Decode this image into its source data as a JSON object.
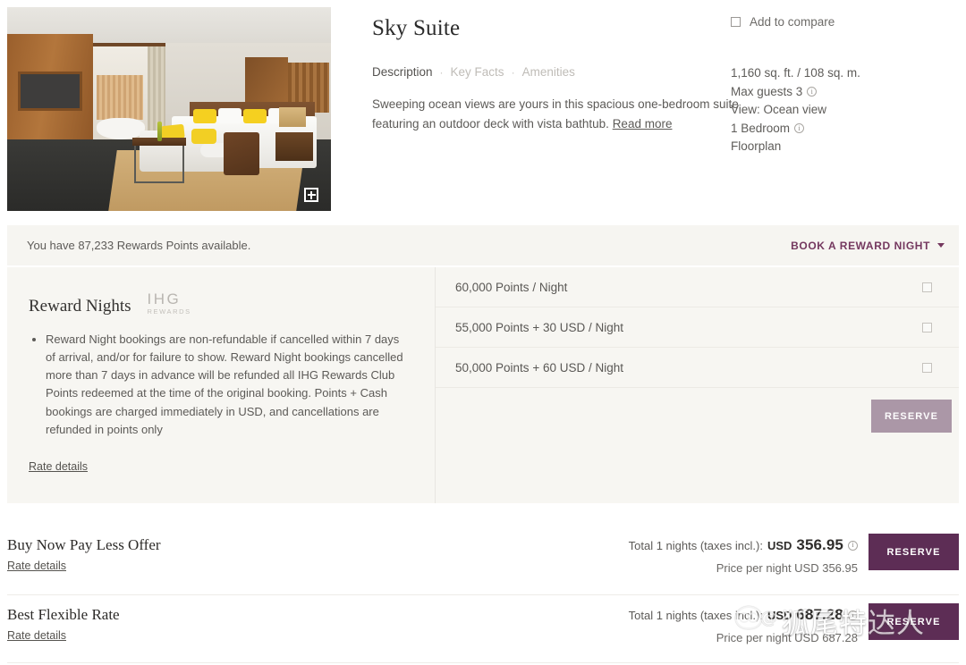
{
  "room": {
    "title": "Sky Suite",
    "photo_alt_name": "suite-photo",
    "expand_icon": "expand-plus-icon",
    "compare_label": "Add to compare",
    "tabs": [
      {
        "label": "Description",
        "active": true
      },
      {
        "label": "Key Facts",
        "active": false
      },
      {
        "label": "Amenities",
        "active": false
      }
    ],
    "tab_separator": "·",
    "description": "Sweeping ocean views are yours in this spacious one-bedroom suite featuring an outdoor deck with vista bathtub.",
    "read_more": "Read more",
    "facts": {
      "size": "1,160 sq. ft. / 108 sq. m.",
      "max_guests": "Max guests 3",
      "view": "View: Ocean view",
      "bedrooms": "1 Bedroom",
      "floorplan": "Floorplan"
    }
  },
  "rewards_banner": {
    "points_available": "You have 87,233 Rewards Points available.",
    "book_link": "BOOK A REWARD NIGHT",
    "chevron_icon": "chevron-down-icon"
  },
  "reward_panel": {
    "title": "Reward Nights",
    "logo_main": "IHG",
    "logo_sub": "REWARDS",
    "terms": "Reward Night bookings are non-refundable if cancelled within 7 days of arrival, and/or for failure to show. Reward Night bookings cancelled more than 7 days in advance will be refunded all IHG Rewards Club Points redeemed at the time of the original booking. Points + Cash bookings are charged immediately in USD, and cancellations are refunded in points only",
    "rate_details": "Rate details",
    "options": [
      {
        "label": "60,000 Points / Night",
        "selected": false
      },
      {
        "label": "55,000 Points + 30 USD / Night",
        "selected": false
      },
      {
        "label": "50,000 Points + 60 USD / Night",
        "selected": false
      }
    ],
    "reserve_label": "RESERVE",
    "reserve_disabled": true
  },
  "rates": [
    {
      "name": "Buy Now Pay Less Offer",
      "rate_details": "Rate details",
      "total_prefix": "Total 1 nights (taxes incl.):",
      "currency": "USD",
      "total_amount": "356.95",
      "per_night": "Price per night USD 356.95",
      "info_icon": "info-icon",
      "reserve_label": "RESERVE"
    },
    {
      "name": "Best Flexible Rate",
      "rate_details": "Rate details",
      "total_prefix": "Total 1 nights (taxes incl.):",
      "currency": "USD",
      "total_amount": "687.28",
      "per_night": "Price per night USD 687.28",
      "info_icon": "info-icon",
      "reserve_label": "RESERVE"
    }
  ],
  "watermark": {
    "at": "@",
    "text": "狐尾特达人",
    "logo_icon": "owl-logo-icon"
  },
  "colors": {
    "accent_purple": "#5d2d55",
    "link_purple": "#74385f",
    "muted_button": "#ab97a7",
    "panel_bg": "#f7f6f2",
    "banner_bg": "#f6f5f1"
  }
}
